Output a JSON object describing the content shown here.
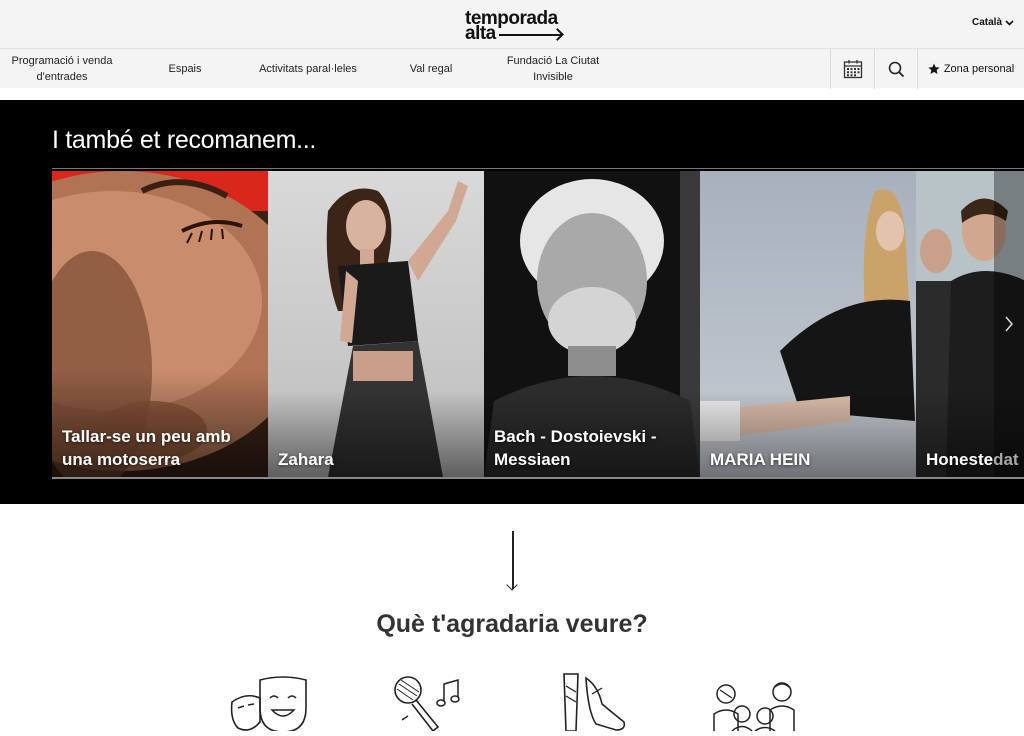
{
  "header": {
    "logo_line1": "temporada",
    "logo_line2": "alta",
    "language": "Català"
  },
  "nav": {
    "items": [
      {
        "label": "Programació i venda d'entrades"
      },
      {
        "label": "Espais"
      },
      {
        "label": "Activitats paral·leles"
      },
      {
        "label": "Val regal"
      },
      {
        "label": "Fundació La Ciutat Invisible"
      }
    ],
    "zona_label": "Zona personal"
  },
  "recommend": {
    "title": "I també et recomanem...",
    "cards": [
      {
        "title": "Tallar-se un peu amb una motoserra"
      },
      {
        "title": "Zahara"
      },
      {
        "title": "Bach - Dostoievski - Messiaen"
      },
      {
        "title": "MARIA HEIN"
      },
      {
        "title": "Honestedat"
      }
    ]
  },
  "question": "Què t'agradaria veure?",
  "categories": [
    {
      "icon": "theatre-masks-icon"
    },
    {
      "icon": "microphone-music-icon"
    },
    {
      "icon": "dance-shoes-icon"
    },
    {
      "icon": "family-icon"
    }
  ],
  "colors": {
    "header_bg": "#f4f4f4",
    "band_bg": "#000000",
    "card1_accent": "#d9271c"
  }
}
